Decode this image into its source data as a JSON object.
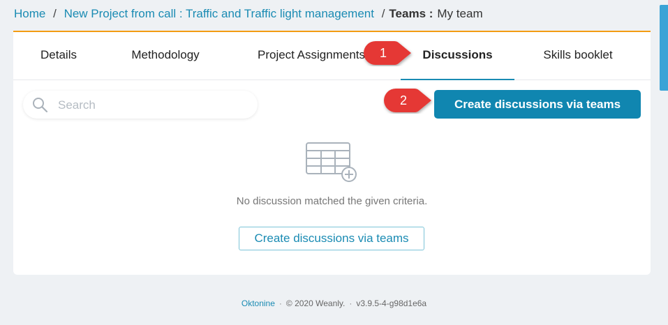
{
  "breadcrumb": {
    "home": "Home",
    "project": "New Project from call : Traffic and Traffic light management",
    "section": "Teams :",
    "current": "My team",
    "separator": "/"
  },
  "tabs": [
    {
      "label": "Details"
    },
    {
      "label": "Methodology"
    },
    {
      "label": "Project Assignments"
    },
    {
      "label": "Discussions",
      "active": true
    },
    {
      "label": "Skills booklet"
    }
  ],
  "search": {
    "placeholder": "Search",
    "value": ""
  },
  "toolbar": {
    "create_label": "Create discussions via teams"
  },
  "empty_state": {
    "icon": "table-add-icon",
    "message": "No discussion matched the given criteria.",
    "button_label": "Create discussions via teams"
  },
  "callouts": [
    {
      "number": "1"
    },
    {
      "number": "2"
    }
  ],
  "footer": {
    "brand": "Oktonine",
    "copyright": "© 2020 Weanly.",
    "version": "v3.9.5-4-g98d1e6a"
  },
  "colors": {
    "accent": "#1086b0",
    "link": "#1a8bb3",
    "tab_border": "#f39c12",
    "callout": "#e53935"
  }
}
